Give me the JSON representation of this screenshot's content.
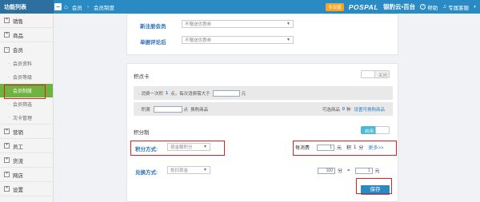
{
  "sidebar": {
    "title": "功能列表",
    "toggle": "−",
    "items": [
      {
        "label": "销售",
        "icon": "⊞"
      },
      {
        "label": "商品",
        "icon": "⊞"
      },
      {
        "label": "会员",
        "icon": "⊟"
      },
      {
        "label": "营销",
        "icon": "⊞"
      },
      {
        "label": "员工",
        "icon": "⊞"
      },
      {
        "label": "货流",
        "icon": "⊞"
      },
      {
        "label": "网店",
        "icon": "⊞"
      },
      {
        "label": "设置",
        "icon": "⊞"
      }
    ],
    "member_sub": [
      "会员资料",
      "会员等级",
      "会员制度",
      "会员筛选",
      "次卡管理"
    ]
  },
  "header": {
    "home_icon": "⌂",
    "breadcrumb_1": "会员",
    "breadcrumb_sep": "›",
    "breadcrumb_2": "会员制度",
    "badge": "专业版",
    "brand_logo": "POSPAL",
    "brand_cn": "银豹云",
    "brand_tail": "▪百台",
    "help": "帮助",
    "support": "专属客服",
    "user_icon": "◐"
  },
  "top_section": {
    "new_member_label": "新注册会员",
    "new_member_select": "不赠送优惠券",
    "review_label": "单据评论后",
    "review_select": "不赠送优惠券"
  },
  "points_card": {
    "title": "积点卡",
    "toggle_label": "关闭",
    "row1_prefix": "消费一次积",
    "row1_value": "1",
    "row1_mid": "点，每次消费需大于",
    "row1_amount": "",
    "row1_unit": "元",
    "row2_prefix": "积满",
    "row2_amount": "",
    "row2_mid": "点",
    "row2_suffix": "换购商品",
    "row2_right_prefix": "可选商品",
    "row2_right_count": "0",
    "row2_right_unit": "种",
    "row2_right_link": "设置可换购商品"
  },
  "points_system": {
    "title": "积分制",
    "toggle_label": "启用",
    "method_label": "积分方式:",
    "method_select": "按金额积分",
    "consume_label": "每消费",
    "consume_amount": "1",
    "consume_unit": "元",
    "earn_label": "积",
    "earn_points": "1",
    "earn_unit": "分",
    "more_link": "更多>>",
    "exchange_label": "兑换方式:",
    "exchange_select": "抵扣现金",
    "exchange_points": "100",
    "exchange_points_unit": "分",
    "exchange_eq": "=",
    "exchange_cash": "1",
    "exchange_cash_unit": "元",
    "save_button": "保存"
  }
}
